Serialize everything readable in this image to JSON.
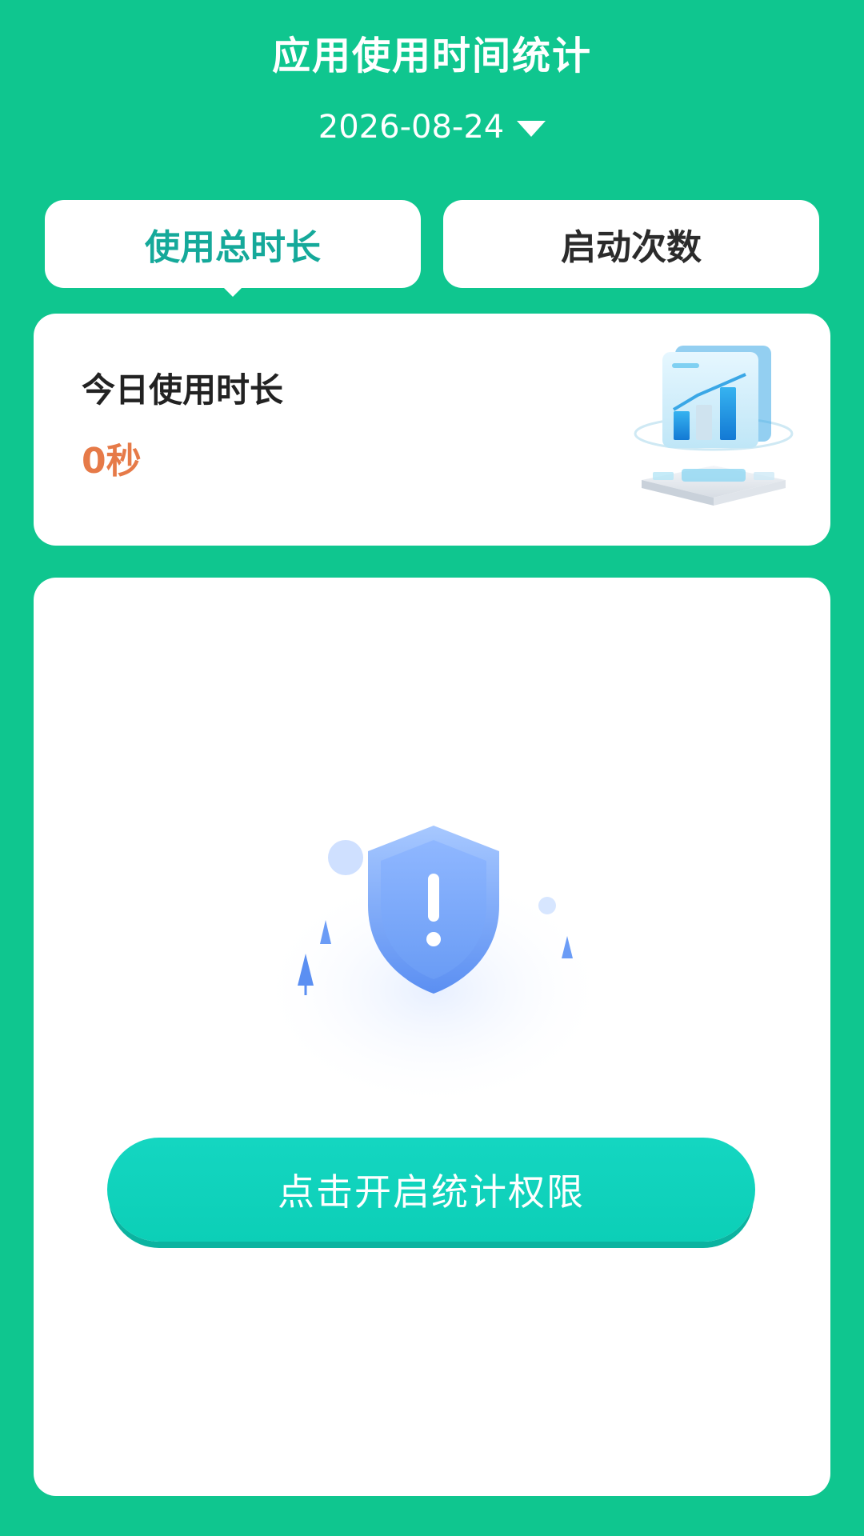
{
  "header": {
    "title": "应用使用时间统计",
    "date": "2026-08-24",
    "date_dropdown_icon": "caret-down-icon"
  },
  "tabs": [
    {
      "label": "使用总时长",
      "selected": true
    },
    {
      "label": "启动次数",
      "selected": false
    }
  ],
  "today": {
    "label": "今日使用时长",
    "value": "0秒",
    "illustration_icon": "bar-chart-illustration-icon"
  },
  "permission": {
    "illustration_icon": "shield-warning-icon",
    "button_label": "点击开启统计权限"
  },
  "colors": {
    "background": "#0fc68f",
    "accent_teal": "#15a99a",
    "value_orange": "#e67a48",
    "button": "#0fd4bd"
  }
}
